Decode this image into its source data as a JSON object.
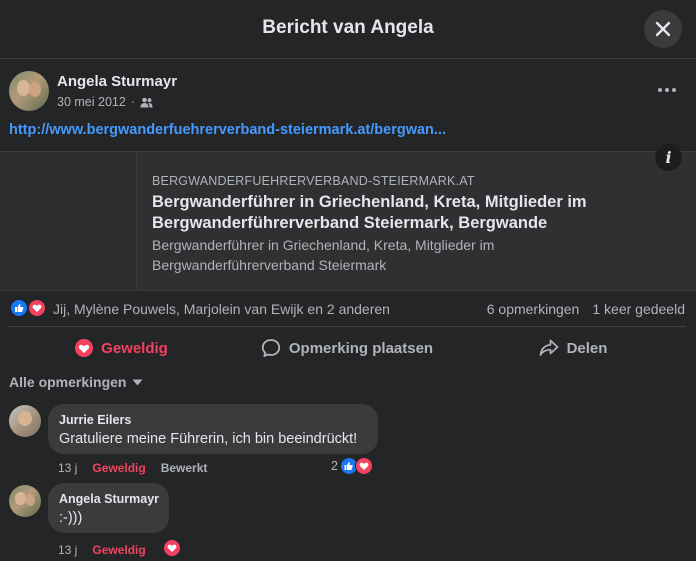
{
  "dialog": {
    "title": "Bericht van Angela"
  },
  "post": {
    "author": "Angela Sturmayr",
    "date": "30 mei 2012",
    "audience_icon": "friends-icon",
    "link": "http://www.bergwanderfuehrerverband-steiermark.at/bergwan...",
    "preview": {
      "domain": "BERGWANDERFUEHRERVERBAND-STEIERMARK.AT",
      "title": "Bergwanderführer in Griechenland, Kreta, Mitglieder im Bergwanderführerverband Steiermark, Bergwande",
      "description": "Bergwanderführer in Griechenland, Kreta, Mitglieder im Bergwanderführerverband Steiermark",
      "info_label": "i"
    }
  },
  "reactions": {
    "names": "Jij, Mylène Pouwels, Marjolein van Ewijk en 2 anderen",
    "comments_count": "6 opmerkingen",
    "shares_count": "1 keer gedeeld"
  },
  "actions": {
    "like": "Geweldig",
    "comment": "Opmerking plaatsen",
    "share": "Delen"
  },
  "comments_filter": "Alle opmerkingen",
  "comments": [
    {
      "author": "Jurrie Eilers",
      "text": "Gratuliere meine Führerin, ich bin beeindrückt!",
      "time": "13 j",
      "like_label": "Geweldig",
      "extra_label": "Bewerkt",
      "reaction_count": "2"
    },
    {
      "author": "Angela Sturmayr",
      "text": ":-)))",
      "time": "13 j",
      "like_label": "Geweldig"
    }
  ],
  "colors": {
    "link": "#4599ff",
    "love": "#f3425f",
    "like": "#1877f2",
    "surface": "#242526",
    "bubble": "#3a3b3c"
  }
}
